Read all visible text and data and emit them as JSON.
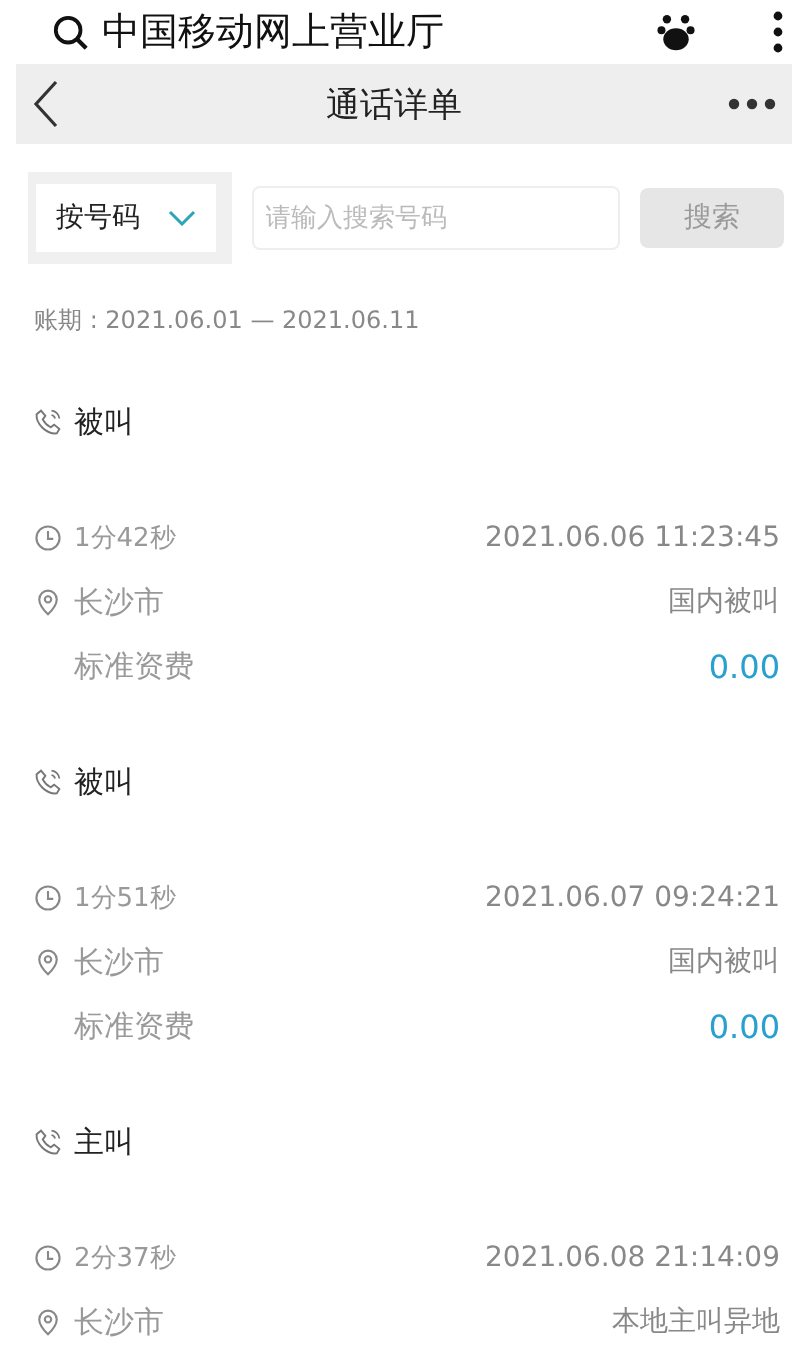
{
  "browser_bar": {
    "title": "中国移动网上营业厅"
  },
  "header": {
    "title": "通话详单"
  },
  "search": {
    "filter": "按号码",
    "placeholder": "请输入搜索号码",
    "button": "搜索",
    "button_disabled": true
  },
  "period": "账期 : 2021.06.01 — 2021.06.11",
  "records": [
    {
      "call_type": "被叫",
      "duration": "1分42秒",
      "time": "2021.06.06 11:23:45",
      "location": "长沙市",
      "category": "国内被叫",
      "fee_label": "标准资费",
      "fee": "0.00"
    },
    {
      "call_type": "被叫",
      "duration": "1分51秒",
      "time": "2021.06.07 09:24:21",
      "location": "长沙市",
      "category": "国内被叫",
      "fee_label": "标准资费",
      "fee": "0.00"
    },
    {
      "call_type": "主叫",
      "duration": "2分37秒",
      "time": "2021.06.08 21:14:09",
      "location": "长沙市",
      "category": "本地主叫异地"
    }
  ]
}
